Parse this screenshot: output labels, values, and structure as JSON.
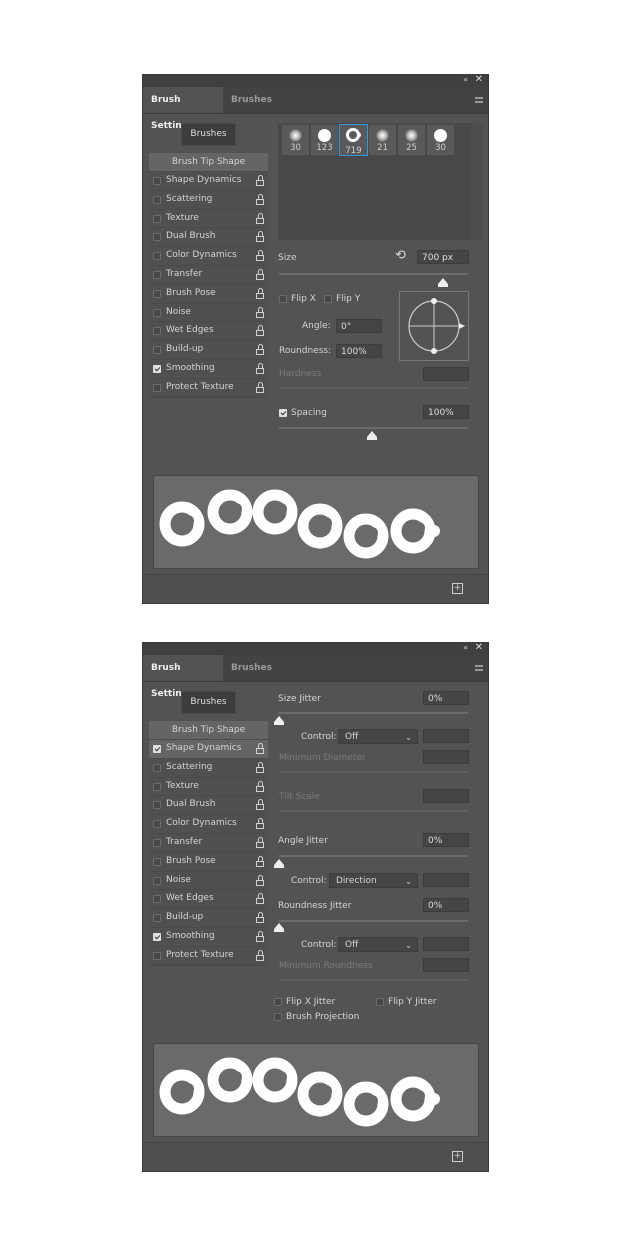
{
  "panels": [
    {
      "tabs": {
        "active": "Brush Settings",
        "inactive": "Brushes"
      },
      "brushes_button": "Brushes",
      "sidebar": {
        "head": "Brush Tip Shape",
        "items": [
          {
            "label": "Shape Dynamics",
            "checked": false
          },
          {
            "label": "Scattering",
            "checked": false
          },
          {
            "label": "Texture",
            "checked": false
          },
          {
            "label": "Dual Brush",
            "checked": false
          },
          {
            "label": "Color Dynamics",
            "checked": false
          },
          {
            "label": "Transfer",
            "checked": false
          },
          {
            "label": "Brush Pose",
            "checked": false
          },
          {
            "label": "Noise",
            "checked": false
          },
          {
            "label": "Wet Edges",
            "checked": false
          },
          {
            "label": "Build-up",
            "checked": false
          },
          {
            "label": "Smoothing",
            "checked": true
          },
          {
            "label": "Protect Texture",
            "checked": false
          }
        ]
      },
      "presets": [
        {
          "size": "30",
          "type": "soft"
        },
        {
          "size": "123",
          "type": "hard"
        },
        {
          "size": "719",
          "type": "chain",
          "selected": true
        },
        {
          "size": "21",
          "type": "soft"
        },
        {
          "size": "25",
          "type": "soft"
        },
        {
          "size": "30",
          "type": "hard"
        }
      ],
      "size": {
        "label": "Size",
        "value": "700 px",
        "slider_percent": 87
      },
      "flip_x": {
        "label": "Flip X",
        "checked": false
      },
      "flip_y": {
        "label": "Flip Y",
        "checked": false
      },
      "angle": {
        "label": "Angle:",
        "value": "0°"
      },
      "roundness": {
        "label": "Roundness:",
        "value": "100%"
      },
      "hardness": {
        "label": "Hardness",
        "value": ""
      },
      "spacing": {
        "label": "Spacing",
        "value": "100%",
        "checked": true,
        "slider_percent": 49
      }
    },
    {
      "tabs": {
        "active": "Brush Settings",
        "inactive": "Brushes"
      },
      "brushes_button": "Brushes",
      "sidebar": {
        "head": "Brush Tip Shape",
        "items": [
          {
            "label": "Shape Dynamics",
            "checked": true,
            "selected": true
          },
          {
            "label": "Scattering",
            "checked": false
          },
          {
            "label": "Texture",
            "checked": false
          },
          {
            "label": "Dual Brush",
            "checked": false
          },
          {
            "label": "Color Dynamics",
            "checked": false
          },
          {
            "label": "Transfer",
            "checked": false
          },
          {
            "label": "Brush Pose",
            "checked": false
          },
          {
            "label": "Noise",
            "checked": false
          },
          {
            "label": "Wet Edges",
            "checked": false
          },
          {
            "label": "Build-up",
            "checked": false
          },
          {
            "label": "Smoothing",
            "checked": true
          },
          {
            "label": "Protect Texture",
            "checked": false
          }
        ]
      },
      "size_jitter": {
        "label": "Size Jitter",
        "value": "0%",
        "slider_percent": 0
      },
      "control1": {
        "label": "Control:",
        "value": "Off"
      },
      "min_diameter": {
        "label": "Minimum Diameter"
      },
      "tilt_scale": {
        "label": "Tilt Scale"
      },
      "angle_jitter": {
        "label": "Angle Jitter",
        "value": "0%",
        "slider_percent": 0
      },
      "control2": {
        "label": "Control:",
        "value": "Direction"
      },
      "roundness_jitter": {
        "label": "Roundness Jitter",
        "value": "0%",
        "slider_percent": 0
      },
      "control3": {
        "label": "Control:",
        "value": "Off"
      },
      "min_roundness": {
        "label": "Minimum Roundness"
      },
      "flip_x_jitter": {
        "label": "Flip X Jitter",
        "checked": false
      },
      "flip_y_jitter": {
        "label": "Flip Y Jitter",
        "checked": false
      },
      "brush_projection": {
        "label": "Brush Projection",
        "checked": false
      }
    }
  ]
}
